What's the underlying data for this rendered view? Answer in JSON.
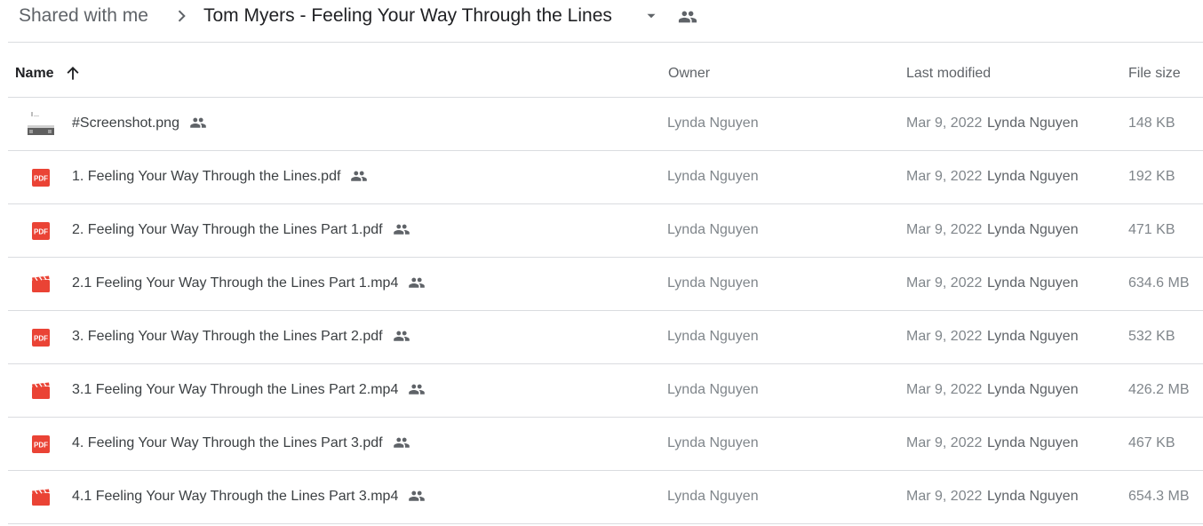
{
  "breadcrumb": {
    "root": "Shared with me",
    "current": "Tom Myers - Feeling Your Way Through the Lines"
  },
  "columns": {
    "name": "Name",
    "owner": "Owner",
    "last_modified": "Last modified",
    "file_size": "File size"
  },
  "sort": {
    "column": "Name",
    "direction": "ascending",
    "icon": "arrow-up-icon"
  },
  "colors": {
    "pdf": "#ea4335",
    "video": "#ea4335",
    "icon_gray": "#5f6368",
    "divider": "#dadce0"
  },
  "files": [
    {
      "name": "#Screenshot.png",
      "type": "image",
      "icon": "image-thumbnail",
      "shared": true,
      "owner": "Lynda Nguyen",
      "modified_date": "Mar 9, 2022",
      "modified_by": "Lynda Nguyen",
      "size": "148 KB"
    },
    {
      "name": "1. Feeling Your Way Through the Lines.pdf",
      "type": "pdf",
      "icon": "pdf-icon",
      "shared": true,
      "owner": "Lynda Nguyen",
      "modified_date": "Mar 9, 2022",
      "modified_by": "Lynda Nguyen",
      "size": "192 KB"
    },
    {
      "name": "2. Feeling Your Way Through the Lines Part 1.pdf",
      "type": "pdf",
      "icon": "pdf-icon",
      "shared": true,
      "owner": "Lynda Nguyen",
      "modified_date": "Mar 9, 2022",
      "modified_by": "Lynda Nguyen",
      "size": "471 KB"
    },
    {
      "name": "2.1 Feeling Your Way Through the Lines Part 1.mp4",
      "type": "video",
      "icon": "video-icon",
      "shared": true,
      "owner": "Lynda Nguyen",
      "modified_date": "Mar 9, 2022",
      "modified_by": "Lynda Nguyen",
      "size": "634.6 MB"
    },
    {
      "name": "3. Feeling Your Way Through the Lines Part 2.pdf",
      "type": "pdf",
      "icon": "pdf-icon",
      "shared": true,
      "owner": "Lynda Nguyen",
      "modified_date": "Mar 9, 2022",
      "modified_by": "Lynda Nguyen",
      "size": "532 KB"
    },
    {
      "name": "3.1 Feeling Your Way Through the Lines Part 2.mp4",
      "type": "video",
      "icon": "video-icon",
      "shared": true,
      "owner": "Lynda Nguyen",
      "modified_date": "Mar 9, 2022",
      "modified_by": "Lynda Nguyen",
      "size": "426.2 MB"
    },
    {
      "name": "4. Feeling Your Way Through the Lines Part 3.pdf",
      "type": "pdf",
      "icon": "pdf-icon",
      "shared": true,
      "owner": "Lynda Nguyen",
      "modified_date": "Mar 9, 2022",
      "modified_by": "Lynda Nguyen",
      "size": "467 KB"
    },
    {
      "name": "4.1 Feeling Your Way Through the Lines Part 3.mp4",
      "type": "video",
      "icon": "video-icon",
      "shared": true,
      "owner": "Lynda Nguyen",
      "modified_date": "Mar 9, 2022",
      "modified_by": "Lynda Nguyen",
      "size": "654.3 MB"
    }
  ]
}
